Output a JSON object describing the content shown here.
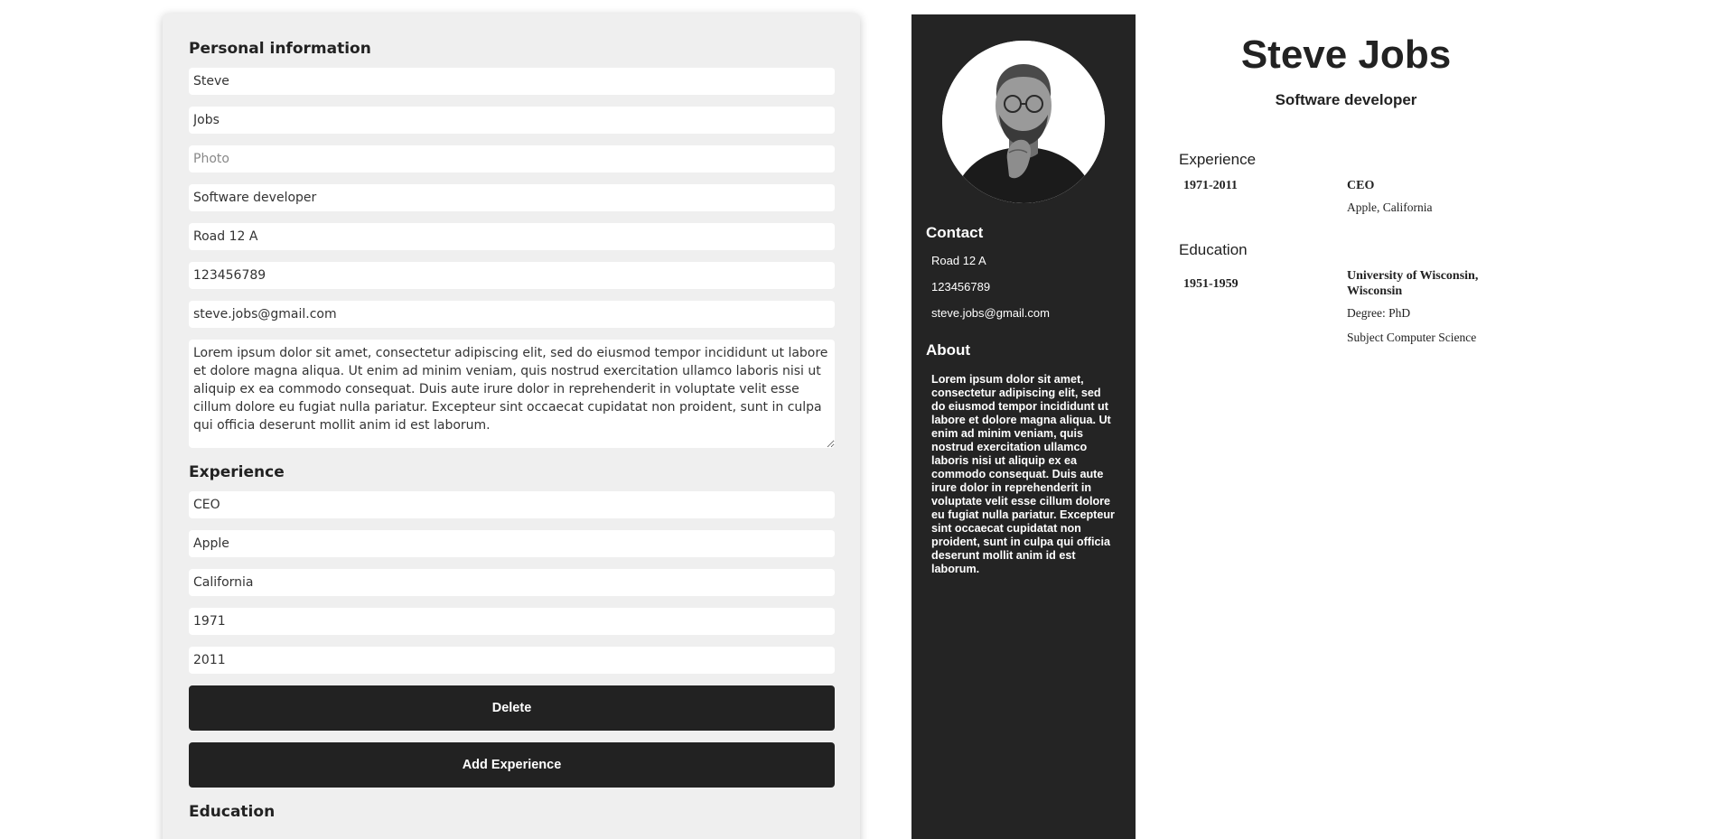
{
  "editor": {
    "personal_title": "Personal information",
    "personal": {
      "first_name": "Steve",
      "last_name": "Jobs",
      "photo_placeholder": "Photo",
      "title": "Software developer",
      "address": "Road 12 A",
      "phone": "123456789",
      "email": "steve.jobs@gmail.com",
      "about": "Lorem ipsum dolor sit amet, consectetur adipiscing elit, sed do eiusmod tempor incididunt ut labore et dolore magna aliqua. Ut enim ad minim veniam, quis nostrud exercitation ullamco laboris nisi ut aliquip ex ea commodo consequat. Duis aute irure dolor in reprehenderit in voluptate velit esse cillum dolore eu fugiat nulla pariatur. Excepteur sint occaecat cupidatat non proident, sunt in culpa qui officia deserunt mollit anim id est laborum."
    },
    "experience_title": "Experience",
    "experience": {
      "position": "CEO",
      "company": "Apple",
      "city": "California",
      "from": "1971",
      "to": "2011"
    },
    "delete_label": "Delete",
    "add_experience_label": "Add Experience",
    "education_title": "Education"
  },
  "cv": {
    "name": "Steve Jobs",
    "title": "Software developer",
    "contact_title": "Contact",
    "address": "Road 12 A",
    "phone": "123456789",
    "email": "steve.jobs@gmail.com",
    "about_title": "About",
    "about": "Lorem ipsum dolor sit amet, consectetur adipiscing elit, sed do eiusmod tempor incididunt ut labore et dolore magna aliqua. Ut enim ad minim veniam, quis nostrud exercitation ullamco laboris nisi ut aliquip ex ea commodo consequat. Duis aute irure dolor in reprehenderit in voluptate velit esse cillum dolore eu fugiat nulla pariatur. Excepteur sint occaecat cupidatat non proident, sunt in culpa qui officia deserunt mollit anim id est laborum.",
    "experience_title": "Experience",
    "experience": {
      "period": "1971-2011",
      "position": "CEO",
      "company_city": "Apple, California"
    },
    "education_title": "Education",
    "education": {
      "period": "1951-1959",
      "university": "University of Wisconsin, Wisconsin",
      "degree": "Degree: PhD",
      "subject": "Subject Computer Science"
    }
  },
  "colors": {
    "sidebar_bg": "#242424",
    "button_bg": "#222222",
    "editor_bg": "#efefef"
  }
}
